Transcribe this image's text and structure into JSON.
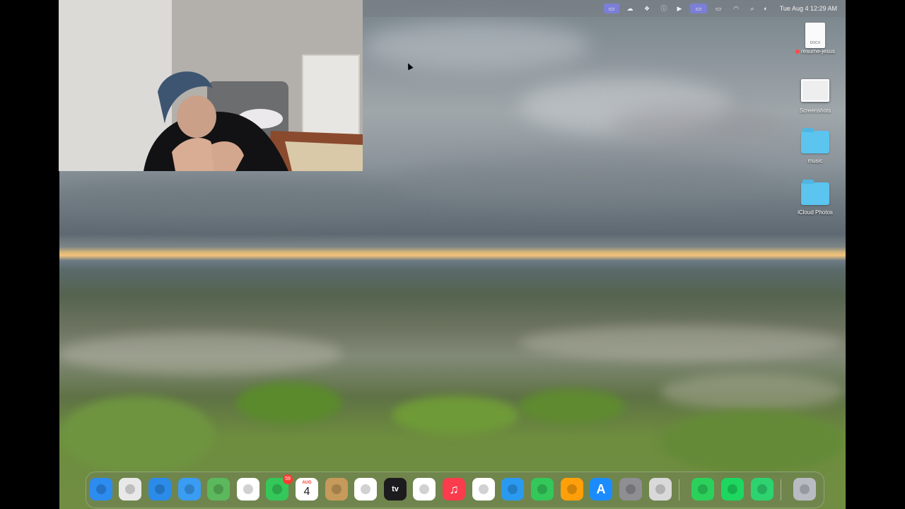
{
  "menubar": {
    "clock": "Tue Aug 4  12:29 AM",
    "status_icons": [
      "screen-record-icon",
      "cloud-icon",
      "dropbox-icon",
      "info-icon",
      "play-icon",
      "window-switch-icon",
      "battery-icon",
      "wifi-icon",
      "search-icon",
      "control-center-icon"
    ]
  },
  "desktop_items": [
    {
      "label": "resume-jesus",
      "type": "document",
      "doc_ext": "DOCX",
      "tag_color": "#ff4a4a"
    },
    {
      "label": "Screenshots",
      "type": "screenshots-folder"
    },
    {
      "label": "music",
      "type": "folder"
    },
    {
      "label": "iCloud Photos",
      "type": "folder"
    }
  ],
  "dock": {
    "apps": [
      {
        "name": "Finder",
        "icon": "finder-icon",
        "color": "#2d8cf0"
      },
      {
        "name": "Launchpad",
        "icon": "launchpad-icon",
        "color": "#e8e8e8"
      },
      {
        "name": "Safari",
        "icon": "safari-icon",
        "color": "#2b8be8"
      },
      {
        "name": "Mail",
        "icon": "mail-icon",
        "color": "#3a9cf2"
      },
      {
        "name": "Maps",
        "icon": "maps-icon",
        "color": "#5cb85c"
      },
      {
        "name": "Photos",
        "icon": "photos-icon",
        "color": "#ffffff"
      },
      {
        "name": "FaceTime",
        "icon": "facetime-icon",
        "color": "#34c759",
        "badge": "59"
      },
      {
        "name": "Calendar",
        "icon": "calendar-icon",
        "color": "#ffffff",
        "month": "AUG",
        "day": "4"
      },
      {
        "name": "Contacts",
        "icon": "contacts-icon",
        "color": "#c69a5a"
      },
      {
        "name": "Reminders",
        "icon": "reminders-icon",
        "color": "#ffffff"
      },
      {
        "name": "TV",
        "icon": "tv-icon",
        "color": "#1c1c1e",
        "text": "tv"
      },
      {
        "name": "Freeform",
        "icon": "freeform-icon",
        "color": "#ffffff"
      },
      {
        "name": "Music",
        "icon": "music-icon",
        "color": "#fa3c4c",
        "text": "♫"
      },
      {
        "name": "News",
        "icon": "news-icon",
        "color": "#ffffff"
      },
      {
        "name": "Keynote",
        "icon": "keynote-icon",
        "color": "#2a9af0"
      },
      {
        "name": "Numbers",
        "icon": "numbers-icon",
        "color": "#34c759"
      },
      {
        "name": "Pages",
        "icon": "pages-icon",
        "color": "#ff9f0a"
      },
      {
        "name": "App Store",
        "icon": "app-store-icon",
        "color": "#1a8cff",
        "text": "A"
      },
      {
        "name": "System Settings",
        "icon": "settings-icon",
        "color": "#8e8e93"
      },
      {
        "name": "iPhone Mirroring",
        "icon": "iphone-mirroring-icon",
        "color": "#d9d9d9"
      },
      {
        "name": "Robinhood",
        "icon": "robinhood-icon",
        "color": "#2cd15b"
      },
      {
        "name": "Spotify",
        "icon": "spotify-icon",
        "color": "#1ed760"
      },
      {
        "name": "Discord",
        "icon": "discord-icon",
        "color": "#2dd36f"
      },
      {
        "name": "Trash",
        "icon": "trash-icon",
        "color": "#b8bcc2"
      }
    ]
  }
}
